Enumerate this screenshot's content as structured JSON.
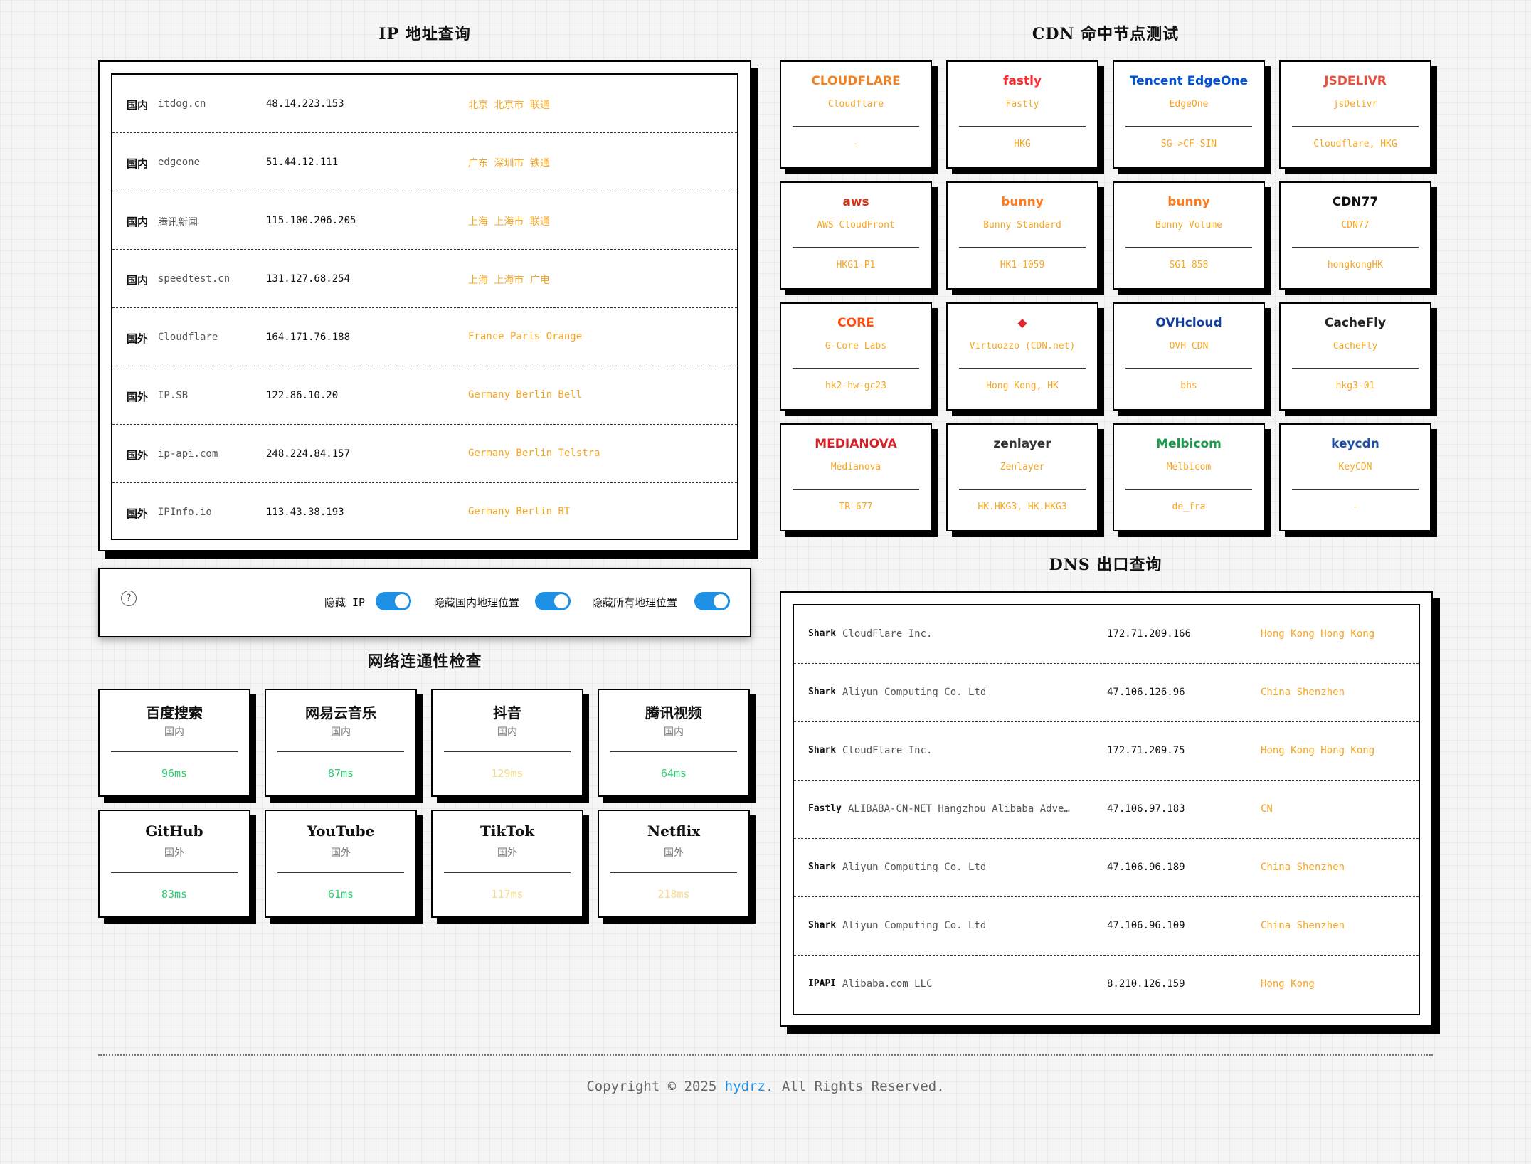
{
  "ip_section": {
    "title": "IP 地址查询",
    "rows": [
      {
        "tag": "国内",
        "name": "itdog.cn",
        "ip": "48.14.223.153",
        "loc": "北京 北京市 联通"
      },
      {
        "tag": "国内",
        "name": "edgeone",
        "ip": "51.44.12.111",
        "loc": "广东 深圳市 铁通"
      },
      {
        "tag": "国内",
        "name": "腾讯新闻",
        "ip": "115.100.206.205",
        "loc": "上海 上海市 联通"
      },
      {
        "tag": "国内",
        "name": "speedtest.cn",
        "ip": "131.127.68.254",
        "loc": "上海 上海市 广电"
      },
      {
        "tag": "国外",
        "name": "Cloudflare",
        "ip": "164.171.76.188",
        "loc": "France Paris Orange"
      },
      {
        "tag": "国外",
        "name": "IP.SB",
        "ip": "122.86.10.20",
        "loc": "Germany Berlin Bell"
      },
      {
        "tag": "国外",
        "name": "ip-api.com",
        "ip": "248.224.84.157",
        "loc": "Germany Berlin Telstra"
      },
      {
        "tag": "国外",
        "name": "IPInfo.io",
        "ip": "113.43.38.193",
        "loc": "Germany Berlin BT"
      }
    ]
  },
  "settings": {
    "help_icon": "question-circle-icon",
    "hide_ip": "隐藏 IP",
    "hide_domestic": "隐藏国内地理位置",
    "hide_all": "隐藏所有地理位置"
  },
  "network_section": {
    "title": "网络连通性检查",
    "cards": [
      {
        "name": "百度搜索",
        "region": "国内",
        "latency": "96ms",
        "color": "#2ecc71"
      },
      {
        "name": "网易云音乐",
        "region": "国内",
        "latency": "87ms",
        "color": "#2ecc71"
      },
      {
        "name": "抖音",
        "region": "国内",
        "latency": "129ms",
        "color": "#f5dc8a"
      },
      {
        "name": "腾讯视频",
        "region": "国内",
        "latency": "64ms",
        "color": "#2ecc71"
      },
      {
        "name": "GitHub",
        "region": "国外",
        "latency": "83ms",
        "color": "#2ecc71"
      },
      {
        "name": "YouTube",
        "region": "国外",
        "latency": "61ms",
        "color": "#2ecc71"
      },
      {
        "name": "TikTok",
        "region": "国外",
        "latency": "117ms",
        "color": "#f5dc8a"
      },
      {
        "name": "Netflix",
        "region": "国外",
        "latency": "218ms",
        "color": "#f5dc8a"
      }
    ]
  },
  "cdn_section": {
    "title": "CDN 命中节点测试",
    "cards": [
      {
        "logo": "CLOUDFLARE",
        "logo_color": "#f38020",
        "name": "Cloudflare",
        "value": "-"
      },
      {
        "logo": "fastly",
        "logo_color": "#ff282d",
        "name": "Fastly",
        "value": "HKG"
      },
      {
        "logo": "Tencent EdgeOne",
        "logo_color": "#0052d9",
        "name": "EdgeOne",
        "value": "SG->CF-SIN"
      },
      {
        "logo": "JSDELIVR",
        "logo_color": "#e84d3d",
        "name": "jsDelivr",
        "value": "Cloudflare, HKG"
      },
      {
        "logo": "aws",
        "logo_color": "#d13212",
        "name": "AWS CloudFront",
        "value": "HKG1-P1"
      },
      {
        "logo": "bunny",
        "logo_color": "#ff7a1a",
        "name": "Bunny Standard",
        "value": "HK1-1059"
      },
      {
        "logo": "bunny",
        "logo_color": "#ff7a1a",
        "name": "Bunny Volume",
        "value": "SG1-858"
      },
      {
        "logo": "CDN77",
        "logo_color": "#111111",
        "name": "CDN77",
        "value": "hongkongHK"
      },
      {
        "logo": "CORE",
        "logo_color": "#ff4c0d",
        "name": "G-Core Labs",
        "value": "hk2-hw-gc23"
      },
      {
        "logo": "◆",
        "logo_color": "#e0252b",
        "name": "Virtuozzo (CDN.net)",
        "value": "Hong Kong, HK"
      },
      {
        "logo": "OVHcloud",
        "logo_color": "#123f9b",
        "name": "OVH CDN",
        "value": "bhs"
      },
      {
        "logo": "CacheFly",
        "logo_color": "#222222",
        "name": "CacheFly",
        "value": "hkg3-01"
      },
      {
        "logo": "MEDIANOVA",
        "logo_color": "#d61f26",
        "name": "Medianova",
        "value": "TR-677"
      },
      {
        "logo": "zenlayer",
        "logo_color": "#333333",
        "name": "Zenlayer",
        "value": "HK.HKG3, HK.HKG3"
      },
      {
        "logo": "Melbicom",
        "logo_color": "#1a9c4d",
        "name": "Melbicom",
        "value": "de_fra"
      },
      {
        "logo": "keycdn",
        "logo_color": "#1f4fa8",
        "name": "KeyCDN",
        "value": "-"
      }
    ]
  },
  "dns_section": {
    "title": "DNS 出口查询",
    "rows": [
      {
        "src": "Shark",
        "org": "CloudFlare Inc.",
        "ip": "172.71.209.166",
        "loc": "Hong Kong Hong Kong"
      },
      {
        "src": "Shark",
        "org": "Aliyun Computing Co. Ltd",
        "ip": "47.106.126.96",
        "loc": "China Shenzhen"
      },
      {
        "src": "Shark",
        "org": "CloudFlare Inc.",
        "ip": "172.71.209.75",
        "loc": "Hong Kong Hong Kong"
      },
      {
        "src": "Fastly",
        "org": "ALIBABA-CN-NET Hangzhou Alibaba Adve…",
        "ip": "47.106.97.183",
        "loc": "CN"
      },
      {
        "src": "Shark",
        "org": "Aliyun Computing Co. Ltd",
        "ip": "47.106.96.189",
        "loc": "China Shenzhen"
      },
      {
        "src": "Shark",
        "org": "Aliyun Computing Co. Ltd",
        "ip": "47.106.96.109",
        "loc": "China Shenzhen"
      },
      {
        "src": "IPAPI",
        "org": "Alibaba.com LLC",
        "ip": "8.210.126.159",
        "loc": "Hong Kong"
      }
    ]
  },
  "footer": {
    "prefix": "Copyright © 2025 ",
    "link": "hydrz",
    "suffix": ". All Rights Reserved.",
    "link_color": "#1e90e6"
  }
}
